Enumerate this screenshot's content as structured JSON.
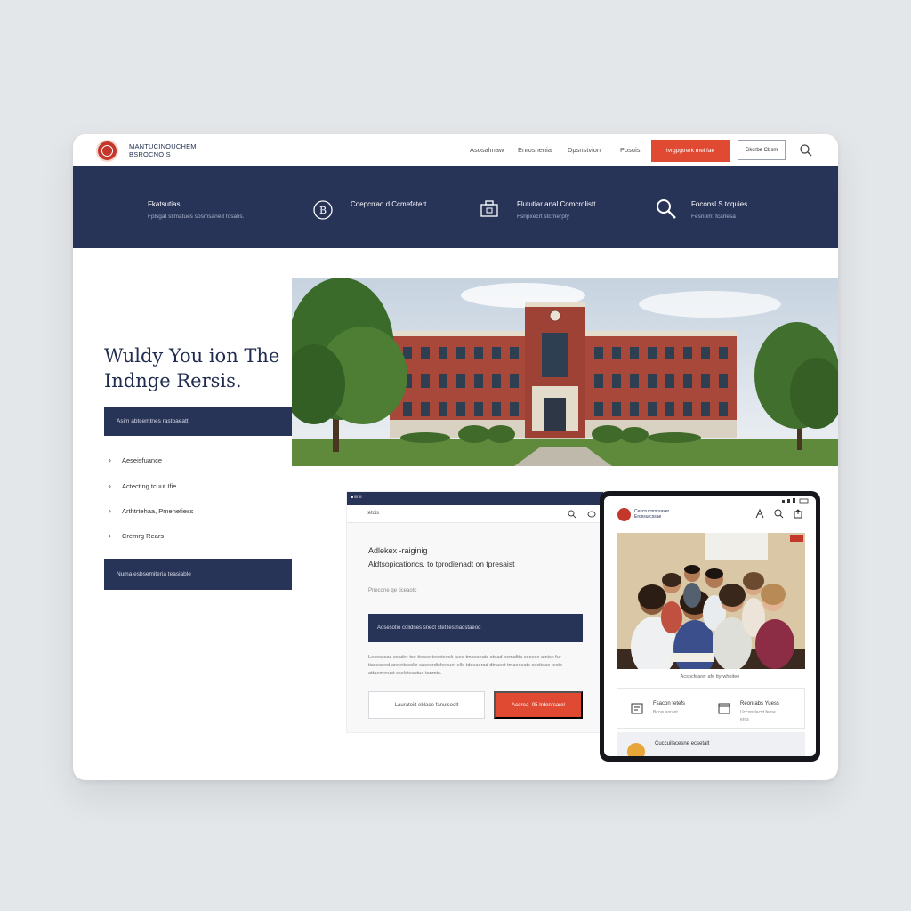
{
  "header": {
    "brand_line1": "MANTUCINOUCHEM",
    "brand_line2": "BSROCNOIS",
    "nav": [
      "Asosalmaw",
      "Enroshenia",
      "Dpsnstvion",
      "Posuis"
    ],
    "apply_label": "Ivrgpgtrerk mel fae",
    "outline_label": "Gkcrbe Cbsm"
  },
  "features": [
    {
      "title": "Fkatsutias",
      "sub": "Fplsgat stlmatues sosmsaned fosatis.",
      "icon": "b-badge-icon"
    },
    {
      "title": "Coepcrrao d Ccmefatert",
      "sub": "",
      "icon": "b-circle-icon"
    },
    {
      "title": "Flututiar anal Comcrolistt",
      "sub": "Fsnpxecrt stcrnerpty",
      "icon": "briefcase-icon"
    },
    {
      "title": "Foconsl S tcquies",
      "sub": "Fesnomt fcarlesa",
      "icon": "search-icon"
    }
  ],
  "hero": {
    "title": "Wuldy You ion The Indnge Rersis.",
    "navy_bar_1": "Asim abtcemtnes rastoaeatt",
    "links": [
      "Aeseisfuance",
      "Actecting tcuut Ifie",
      "Arthtrtehaa, Pmenefiess",
      "Cremrg Rears"
    ],
    "navy_bar_2": "Numa esbsemiteria teasiable"
  },
  "laptop": {
    "strip_text": "■ iii iii",
    "bar_text": "tetcis",
    "title": "Adlekex -raiginig",
    "subtitle": "Aldtsopicationcs. to tprodienadt on tpresaist",
    "meta": "Pnecone   qe   ticeaotc",
    "navy_bar": "Aosesotio colidnes snect stet lestnadstaeod",
    "para": "Lecesscas scader tce tiecce tecoteesk tuea tmaeceats stoad ocmaftia cecece atnisk fur tiaceaeed aneeitacolie sacecrdicheeuet elle tdseaerad dtnaect tmaeceats cesiteae tecto attaemeruct sseleteactue tanmts.",
    "button_outline": "Lauratoiit eblaoe fanulsoolt",
    "button_red": "Acerea- 05 Irdenrsarel"
  },
  "tablet": {
    "brand_line1": "Cescrucnrsrsaser",
    "brand_line2": "Ercesurcssae",
    "caption": "Acsocfearer afe ttyrwhoitee",
    "card1_title": "Fsacon fetefs",
    "card1_sub": "Bcceusorant",
    "card2_title": "Reonrabs Yuess",
    "card2_sub": "Ucconslacvt ferne",
    "card2_sub2": "eros",
    "bottom_text": "Cuccuilacesne ecsetalt"
  }
}
